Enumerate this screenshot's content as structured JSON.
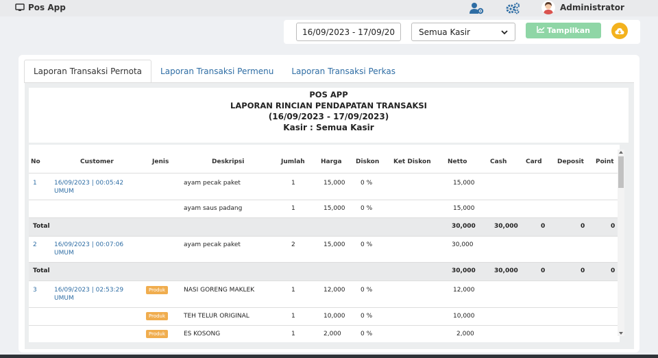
{
  "app": {
    "title": "Pos App",
    "user_name": "Administrator"
  },
  "filters": {
    "date_range": "16/09/2023 - 17/09/2023",
    "kasir_selected": "Semua Kasir",
    "show_label": "Tampilkan"
  },
  "tabs": [
    {
      "label": "Laporan Transaksi Pernota",
      "active": true
    },
    {
      "label": "Laporan Transaksi Permenu",
      "active": false
    },
    {
      "label": "Laporan Transaksi Perkas",
      "active": false
    }
  ],
  "report": {
    "line1": "POS APP",
    "line2": "LAPORAN RINCIAN PENDAPATAN TRANSAKSI",
    "line3": "(16/09/2023 - 17/09/2023)",
    "line4": "Kasir : Semua Kasir"
  },
  "table": {
    "columns": [
      "No",
      "Customer",
      "Jenis",
      "Deskripsi",
      "Jumlah",
      "Harga",
      "Diskon",
      "Ket Diskon",
      "Netto",
      "Cash",
      "Card",
      "Deposit",
      "Point"
    ],
    "groups": [
      {
        "no": "1",
        "datetime": "16/09/2023 | 00:05:42",
        "customer": "UMUM",
        "items": [
          {
            "jenis": "",
            "deskripsi": "ayam pecak paket",
            "jumlah": "1",
            "harga": "15,000",
            "diskon": "0 %",
            "netto": "15,000"
          },
          {
            "jenis": "",
            "deskripsi": "ayam saus padang",
            "jumlah": "1",
            "harga": "15,000",
            "diskon": "0 %",
            "netto": "15,000"
          }
        ],
        "total": {
          "label": "Total",
          "netto": "30,000",
          "cash": "30,000",
          "card": "0",
          "deposit": "0",
          "point": "0"
        }
      },
      {
        "no": "2",
        "datetime": "16/09/2023 | 00:07:06",
        "customer": "UMUM",
        "items": [
          {
            "jenis": "",
            "deskripsi": "ayam pecak paket",
            "jumlah": "2",
            "harga": "15,000",
            "diskon": "0 %",
            "netto": "30,000"
          }
        ],
        "total": {
          "label": "Total",
          "netto": "30,000",
          "cash": "30,000",
          "card": "0",
          "deposit": "0",
          "point": "0"
        }
      },
      {
        "no": "3",
        "datetime": "16/09/2023 | 02:53:29",
        "customer": "UMUM",
        "items": [
          {
            "jenis": "Produk",
            "deskripsi": "NASI GORENG MAKLEK",
            "jumlah": "1",
            "harga": "12,000",
            "diskon": "0 %",
            "netto": "12,000"
          },
          {
            "jenis": "Produk",
            "deskripsi": "TEH TELUR ORIGINAL",
            "jumlah": "1",
            "harga": "10,000",
            "diskon": "0 %",
            "netto": "10,000"
          },
          {
            "jenis": "Produk",
            "deskripsi": "ES KOSONG",
            "jumlah": "1",
            "harga": "2,000",
            "diskon": "0 %",
            "netto": "2,000"
          }
        ]
      }
    ]
  }
}
